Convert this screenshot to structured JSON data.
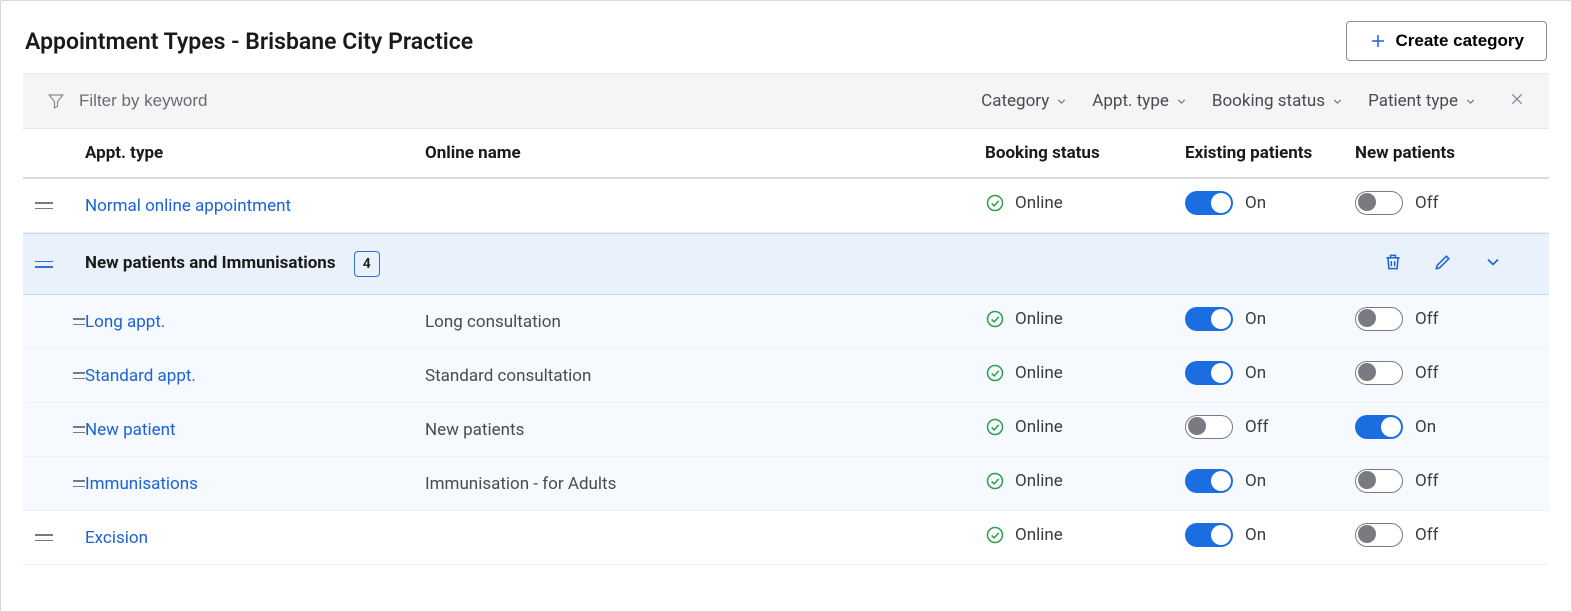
{
  "header": {
    "title": "Appointment Types - Brisbane City Practice",
    "create_label": "Create category"
  },
  "filter": {
    "placeholder": "Filter by keyword",
    "category_label": "Category",
    "appt_type_label": "Appt. type",
    "booking_status_label": "Booking status",
    "patient_type_label": "Patient type"
  },
  "columns": {
    "appt_type": "Appt. type",
    "online_name": "Online name",
    "booking_status": "Booking status",
    "existing_patients": "Existing patients",
    "new_patients": "New patients"
  },
  "status_labels": {
    "online": "Online"
  },
  "toggle_labels": {
    "on": "On",
    "off": "Off"
  },
  "rows": [
    {
      "kind": "item",
      "name": "Normal online appointment",
      "online_name": "",
      "status": "online",
      "existing_on": true,
      "new_on": false
    },
    {
      "kind": "category",
      "name": "New patients and Immunisations",
      "count": "4",
      "children": [
        {
          "name": "Long appt.",
          "online_name": "Long consultation",
          "status": "online",
          "existing_on": true,
          "new_on": false
        },
        {
          "name": "Standard appt.",
          "online_name": "Standard consultation",
          "status": "online",
          "existing_on": true,
          "new_on": false
        },
        {
          "name": "New patient",
          "online_name": "New patients",
          "status": "online",
          "existing_on": false,
          "new_on": true
        },
        {
          "name": "Immunisations",
          "online_name": "Immunisation - for Adults",
          "status": "online",
          "existing_on": true,
          "new_on": false
        }
      ]
    },
    {
      "kind": "item",
      "name": "Excision",
      "online_name": "",
      "status": "online",
      "existing_on": true,
      "new_on": false
    }
  ]
}
